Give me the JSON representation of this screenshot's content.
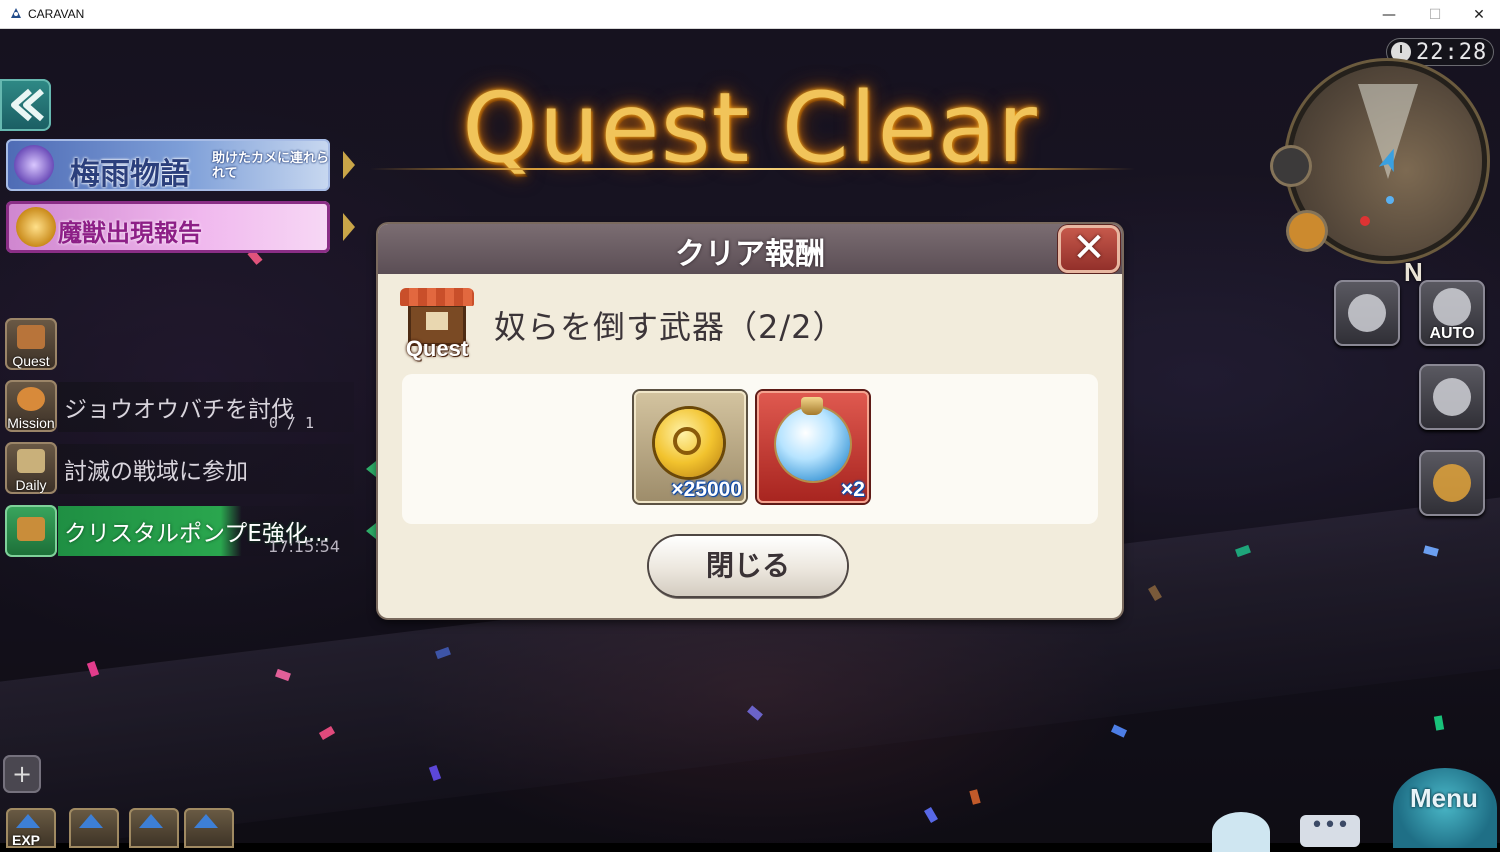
{
  "window": {
    "title": "CARAVAN",
    "minimize": "—",
    "maximize": "☐",
    "close": "✕"
  },
  "scene": {
    "title": "Quest Clear",
    "clock": "22:28",
    "compass_north": "N",
    "menu_label": "Menu",
    "chat_label": "•••"
  },
  "left_hud": {
    "back_icon": "double-chevron-left-icon",
    "event_banner": {
      "title": "梅雨物語",
      "subtitle": "助けたカメに連れられて"
    },
    "beast_banner": {
      "title": "魔獣出現報告"
    },
    "tabs": [
      {
        "label": "Quest"
      },
      {
        "label": "Mission"
      },
      {
        "label": "Daily"
      }
    ],
    "tasks": [
      {
        "text": "ジョウオウバチを討伐",
        "count": "0 / 1"
      },
      {
        "text": "討滅の戦域に参加"
      },
      {
        "text": "クリスタルポンプE強化...",
        "time": "17:15:54"
      }
    ],
    "boosts": [
      {
        "label": "EXP"
      },
      {
        "label": ""
      },
      {
        "label": ""
      },
      {
        "label": ""
      }
    ]
  },
  "right_hud": {
    "auto_label": "AUTO"
  },
  "dialog": {
    "title": "クリア報酬",
    "close_icon": "✕",
    "quest_tag": "Quest",
    "quest_name": "奴らを倒す武器（2/2）",
    "rewards": [
      {
        "name": "gold-coin",
        "quantity": "×25000"
      },
      {
        "name": "crystal-orb",
        "quantity": "×2"
      }
    ],
    "close_button": "閉じる"
  }
}
